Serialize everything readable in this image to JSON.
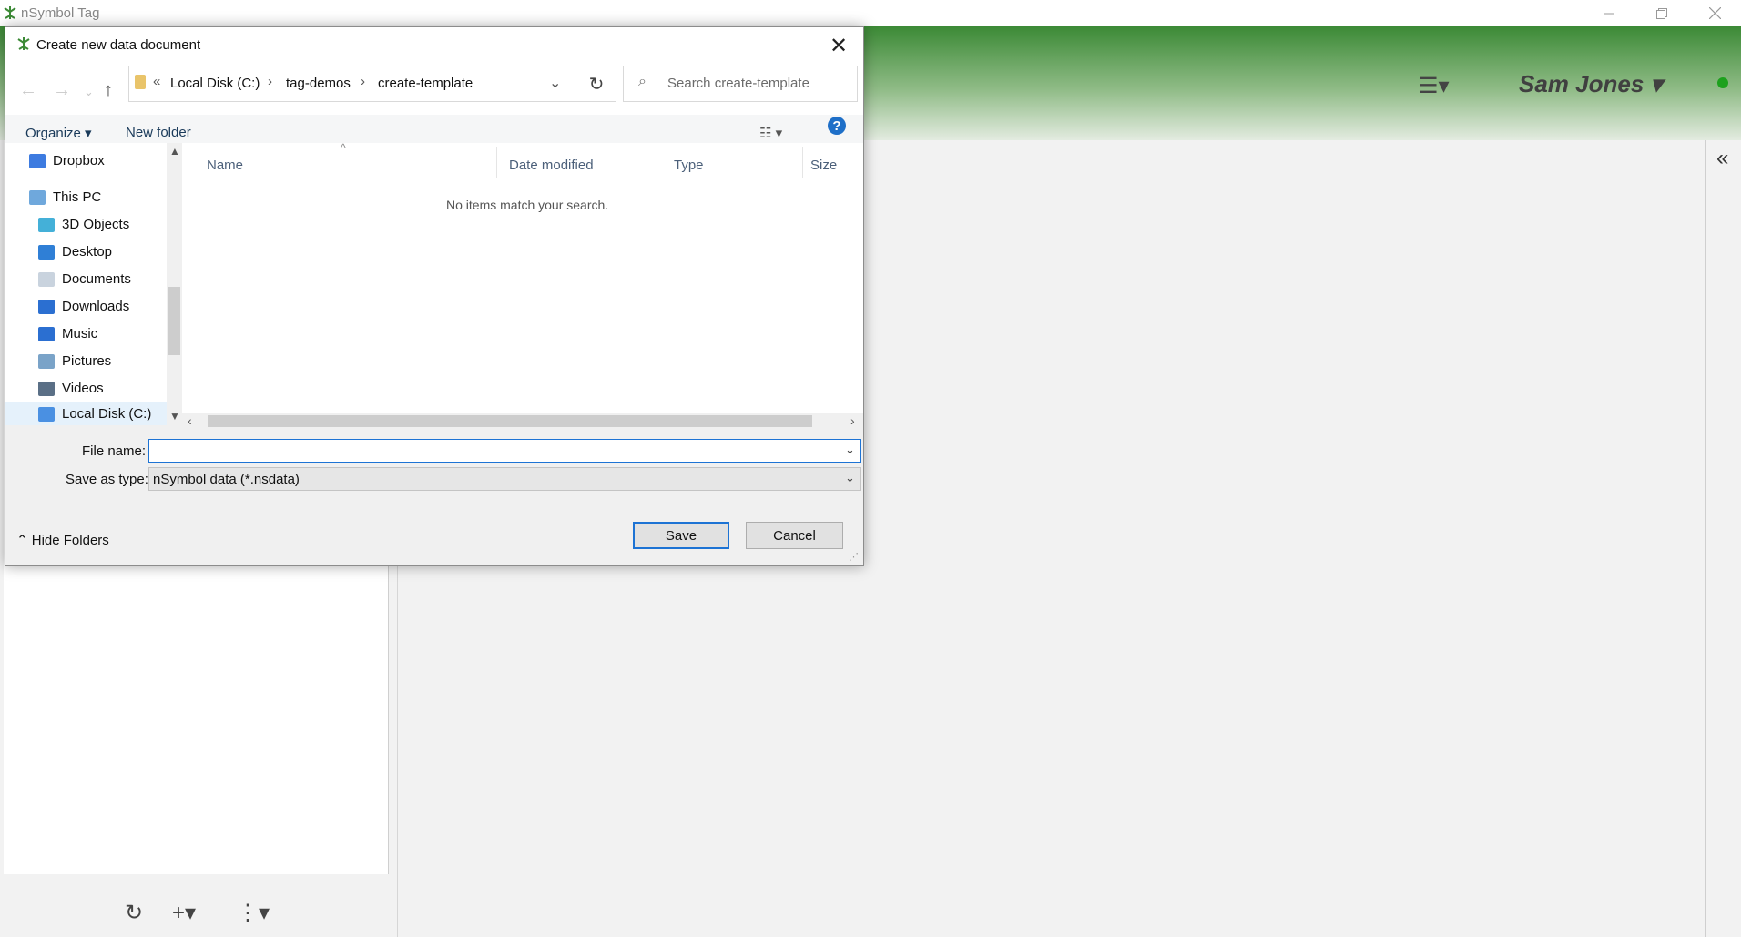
{
  "app": {
    "title": "nSymbol Tag",
    "user_name": "Sam Jones",
    "status_color": "#1da11d",
    "header_color": "#3c8a36"
  },
  "dialog": {
    "title": "Create new data document",
    "address": {
      "overflow": "«",
      "crumbs": [
        "Local Disk (C:)",
        "tag-demos",
        "create-template"
      ]
    },
    "search_placeholder": "Search create-template",
    "toolbar": {
      "organize": "Organize",
      "new_folder": "New folder"
    },
    "nav_items": [
      {
        "label": "Dropbox",
        "icon": "dropbox-icon"
      },
      {
        "label": "This PC",
        "icon": "computer-icon"
      },
      {
        "label": "3D Objects",
        "icon": "cube-icon"
      },
      {
        "label": "Desktop",
        "icon": "desktop-icon"
      },
      {
        "label": "Documents",
        "icon": "documents-icon"
      },
      {
        "label": "Downloads",
        "icon": "download-icon"
      },
      {
        "label": "Music",
        "icon": "music-icon"
      },
      {
        "label": "Pictures",
        "icon": "pictures-icon"
      },
      {
        "label": "Videos",
        "icon": "videos-icon"
      },
      {
        "label": "Local Disk (C:)",
        "icon": "drive-icon"
      }
    ],
    "columns": [
      "Name",
      "Date modified",
      "Type",
      "Size"
    ],
    "empty_message": "No items match your search.",
    "file_name_label": "File name:",
    "file_name_value": "",
    "save_as_type_label": "Save as type:",
    "save_as_type_value": "nSymbol data (*.nsdata)",
    "save_label": "Save",
    "cancel_label": "Cancel",
    "hide_folders_label": "Hide Folders"
  }
}
